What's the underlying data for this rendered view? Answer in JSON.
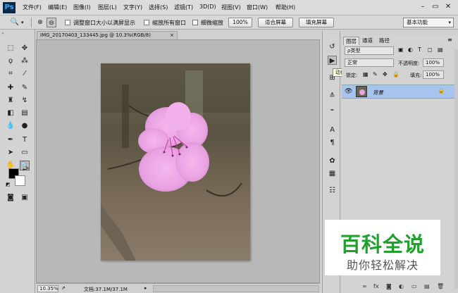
{
  "menubar": {
    "logo": "Ps",
    "items": [
      "文件(F)",
      "编辑(E)",
      "图像(I)",
      "图层(L)",
      "文字(Y)",
      "选择(S)",
      "滤镜(T)",
      "3D(D)",
      "视图(V)",
      "窗口(W)",
      "帮助(H)"
    ],
    "window_controls": {
      "minimize": "–",
      "restore": "▭",
      "close": "✕"
    }
  },
  "options": {
    "check1": "调整窗口大小以满屏显示",
    "check2": "缩放所有窗口",
    "check3": "细微缩放",
    "zoom_value": "100%",
    "fit_screen": "适合屏幕",
    "fill_screen": "填充屏幕",
    "workspace": "基本功能"
  },
  "document": {
    "tab_title": "IMG_20170403_133445.jpg @ 10.3%(RGB/8)",
    "zoom": "10.35%",
    "doc_info": "文档:37.1M/37.1M"
  },
  "dock": {
    "tooltip": "动作"
  },
  "layers_panel": {
    "tabs": [
      "图层",
      "通道",
      "路径"
    ],
    "kind_filter": "ρ类型",
    "blend_mode": "正常",
    "opacity_label": "不透明度:",
    "opacity_value": "100%",
    "lock_label": "锁定:",
    "fill_label": "填充:",
    "fill_value": "100%",
    "layer_name": "背景"
  },
  "watermark": {
    "title": "百科全说",
    "subtitle": "助你轻松解决"
  },
  "colors": {
    "accent_selection": "#a8c4ee",
    "watermark_green": "#1fa22c",
    "ps_logo_bg": "#0c2a44"
  }
}
